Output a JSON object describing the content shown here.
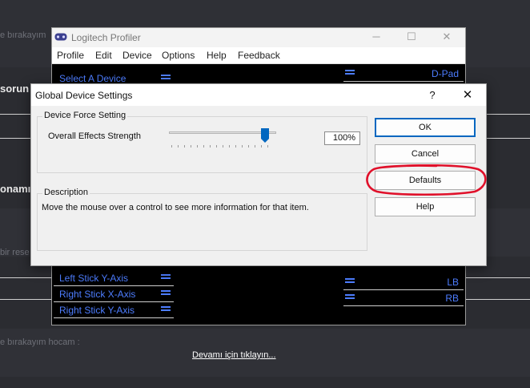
{
  "background_page": {
    "snippet_1": "e bırakayım",
    "snippet_2": "sorun",
    "snippet_3": "onamı",
    "snippet_4": "bir rese",
    "snippet_5": "e bırakayım hocam :",
    "read_more_link": "Devamı için tıklayın..."
  },
  "profiler": {
    "title": "Logitech Profiler",
    "menu": [
      "Profile",
      "Edit",
      "Device",
      "Options",
      "Help",
      "Feedback"
    ],
    "left_items": {
      "select_device": "Select A Device",
      "left_stick_y": "Left Stick Y-Axis",
      "right_stick_x": "Right Stick X-Axis",
      "right_stick_y": "Right Stick Y-Axis"
    },
    "right_items": {
      "dpad": "D-Pad",
      "lb": "LB",
      "rb": "RB"
    }
  },
  "dialog": {
    "title": "Global Device Settings",
    "help_glyph": "?",
    "close_glyph": "✕",
    "force_group": {
      "legend": "Device Force Setting",
      "label": "Overall Effects Strength",
      "value": "100%",
      "slider_level": 0.65
    },
    "description_group": {
      "legend": "Description",
      "text": "Move the mouse over a control to see more information for that item."
    },
    "buttons": {
      "ok": "OK",
      "cancel": "Cancel",
      "defaults": "Defaults",
      "help": "Help"
    }
  },
  "colors": {
    "accent_blue": "#4d7dff",
    "highlight_red": "#e0102a",
    "focus_blue": "#0067c0"
  },
  "icons": [
    "gamepad-icon",
    "minimize-icon",
    "maximize-icon",
    "close-icon",
    "list-bars-icon",
    "slider-thumb-icon",
    "help-icon"
  ]
}
